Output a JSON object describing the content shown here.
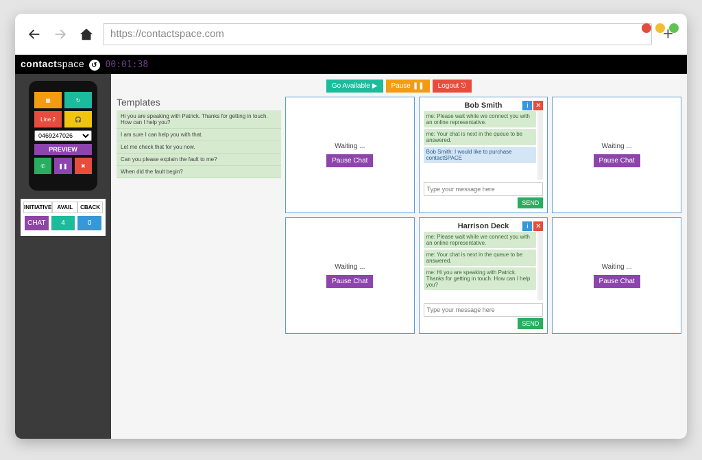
{
  "browser": {
    "url": "https://contactspace.com"
  },
  "app": {
    "logo_a": "contact",
    "logo_b": "space",
    "timer": "00:01:38"
  },
  "phone": {
    "line_label": "Line 2",
    "number": "0469247026",
    "preview": "PREVIEW"
  },
  "stats": {
    "h1": "INITIATIVE",
    "h2": "AVAIL",
    "h3": "CBACK",
    "v1": "CHAT",
    "v2": "4",
    "v3": "0"
  },
  "toolbar": {
    "go_available": "Go Available",
    "pause": "Pause",
    "logout": "Logout"
  },
  "templates": {
    "title": "Templates",
    "items": [
      "Hi you are speaking with Patrick. Thanks for getting in touch. How can I help you?",
      "I am sure I can help you with that.",
      "Let me check that for you now.",
      "Can you please explain the fault to me?",
      "When did the fault begin?"
    ]
  },
  "waiting_label": "Waiting ...",
  "pause_chat_label": "Pause Chat",
  "input_placeholder": "Type your message here",
  "send_label": "SEND",
  "chats": [
    {
      "name": "Bob Smith",
      "messages": [
        {
          "who": "me",
          "text": "me: Please wait while we connect you with an online representative."
        },
        {
          "who": "me",
          "text": "me: Your chat is next in the queue to be answered."
        },
        {
          "who": "them",
          "text": "Bob Smith: I would like to purchase contactSPACE"
        }
      ]
    },
    {
      "name": "Harrison Deck",
      "messages": [
        {
          "who": "me",
          "text": "me: Please wait while we connect you with an online representative."
        },
        {
          "who": "me",
          "text": "me: Your chat is next in the queue to be answered."
        },
        {
          "who": "me",
          "text": "me: Hi you are speaking with Patrick. Thanks for getting in touch. How can I help you?"
        }
      ]
    }
  ]
}
